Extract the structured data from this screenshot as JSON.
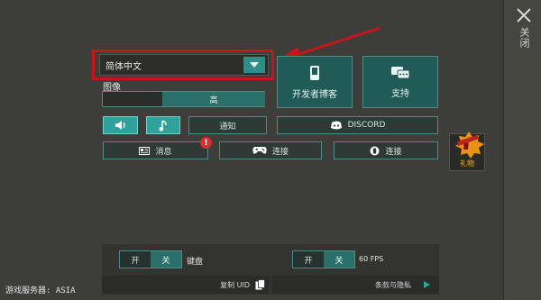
{
  "close": {
    "label": "关闭",
    "icon": "close-icon"
  },
  "language": {
    "selected": "简体中文",
    "icon": "dropdown-arrow-icon"
  },
  "graphics": {
    "label": "图像",
    "quality_label": "高"
  },
  "tiles": {
    "developer_blog": {
      "label": "开发者博客",
      "icon": "phone-icon"
    },
    "support": {
      "label": "支持",
      "icon": "chat-icon"
    }
  },
  "audio": {
    "sound_icon": "speaker-icon",
    "music_icon": "music-note-icon"
  },
  "buttons": {
    "notify": "通知",
    "discord": "DISCORD",
    "messages": "消息",
    "connect_gamepad": "连接",
    "connect_other": "连接"
  },
  "badge": "!",
  "gift": {
    "label": "礼物",
    "icon": "gift-gun-icon"
  },
  "keyboard": {
    "on": "开",
    "off": "关",
    "label": "键盘"
  },
  "fps": {
    "on": "开",
    "off": "关",
    "label": "60 FPS"
  },
  "copy_uid": "复制 UID",
  "terms": "条款与隐私",
  "server": "游戏服务器: ASIA",
  "colors": {
    "accent": "#2fa29b",
    "highlight": "#c4161c",
    "panel": "#215b58"
  }
}
